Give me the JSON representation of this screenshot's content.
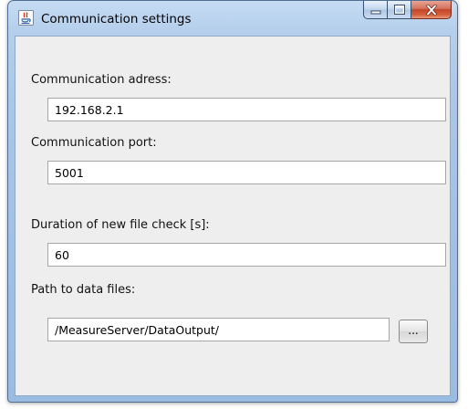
{
  "window": {
    "title": "Communication settings",
    "app_icon": "java-icon",
    "controls": {
      "minimize_icon": "minimize-icon",
      "maximize_icon": "maximize-icon",
      "close_icon": "close-icon"
    }
  },
  "form": {
    "address": {
      "label": "Communication adress:",
      "value": "192.168.2.1"
    },
    "port": {
      "label": "Communication port:",
      "value": "5001"
    },
    "duration": {
      "label": "Duration of new file check [s]:",
      "value": "60"
    },
    "path": {
      "label": "Path to data files:",
      "value": "/MeasureServer/DataOutput/",
      "browse_label": "..."
    }
  },
  "colors": {
    "frame": "#a9c6e8",
    "client_background": "#eeeeee",
    "close_button": "#c2452a"
  }
}
